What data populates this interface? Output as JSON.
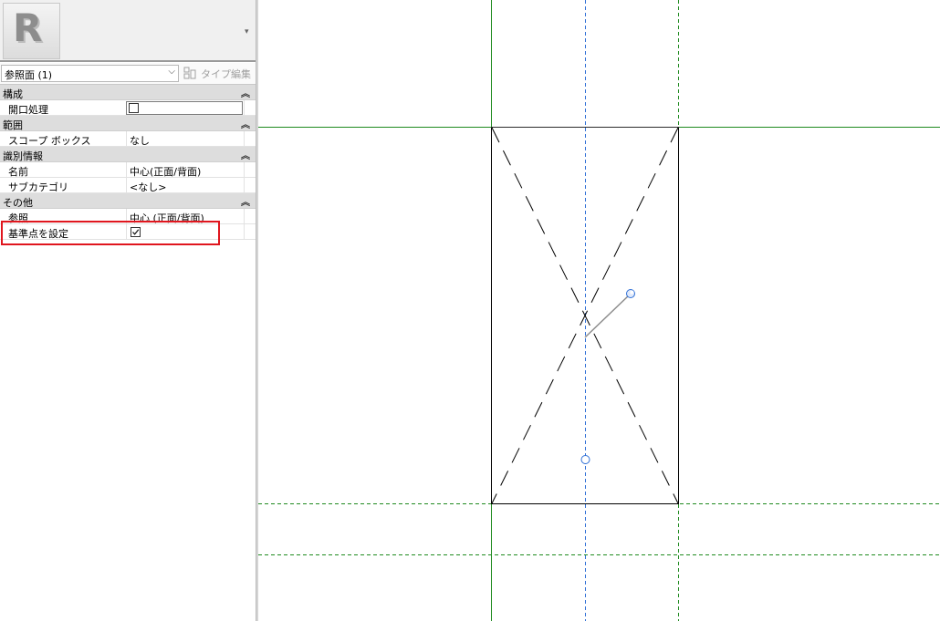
{
  "app": {
    "logo_letter": "R"
  },
  "selector": {
    "type_label": "参照面 (1)",
    "edit_type_label": "タイプ編集"
  },
  "sections": [
    {
      "title": "構成",
      "props": [
        {
          "label": "開口処理",
          "value": "",
          "kind": "checkbox-input",
          "checked": false
        }
      ]
    },
    {
      "title": "範囲",
      "props": [
        {
          "label": "スコープ ボックス",
          "value": "なし"
        }
      ]
    },
    {
      "title": "識別情報",
      "props": [
        {
          "label": "名前",
          "value": "中心(正面/背面)"
        },
        {
          "label": "サブカテゴリ",
          "value": "<なし>"
        }
      ]
    },
    {
      "title": "その他",
      "props": [
        {
          "label": "参照",
          "value": "中心 (正面/背面)"
        },
        {
          "label": "基準点を設定",
          "value": "",
          "kind": "checkbox",
          "checked": true
        }
      ]
    }
  ],
  "colors": {
    "reference_plane": "#1f8a1f",
    "center_line": "#2f6fd6",
    "highlight": "#e0161e",
    "geometry": "#000000"
  }
}
